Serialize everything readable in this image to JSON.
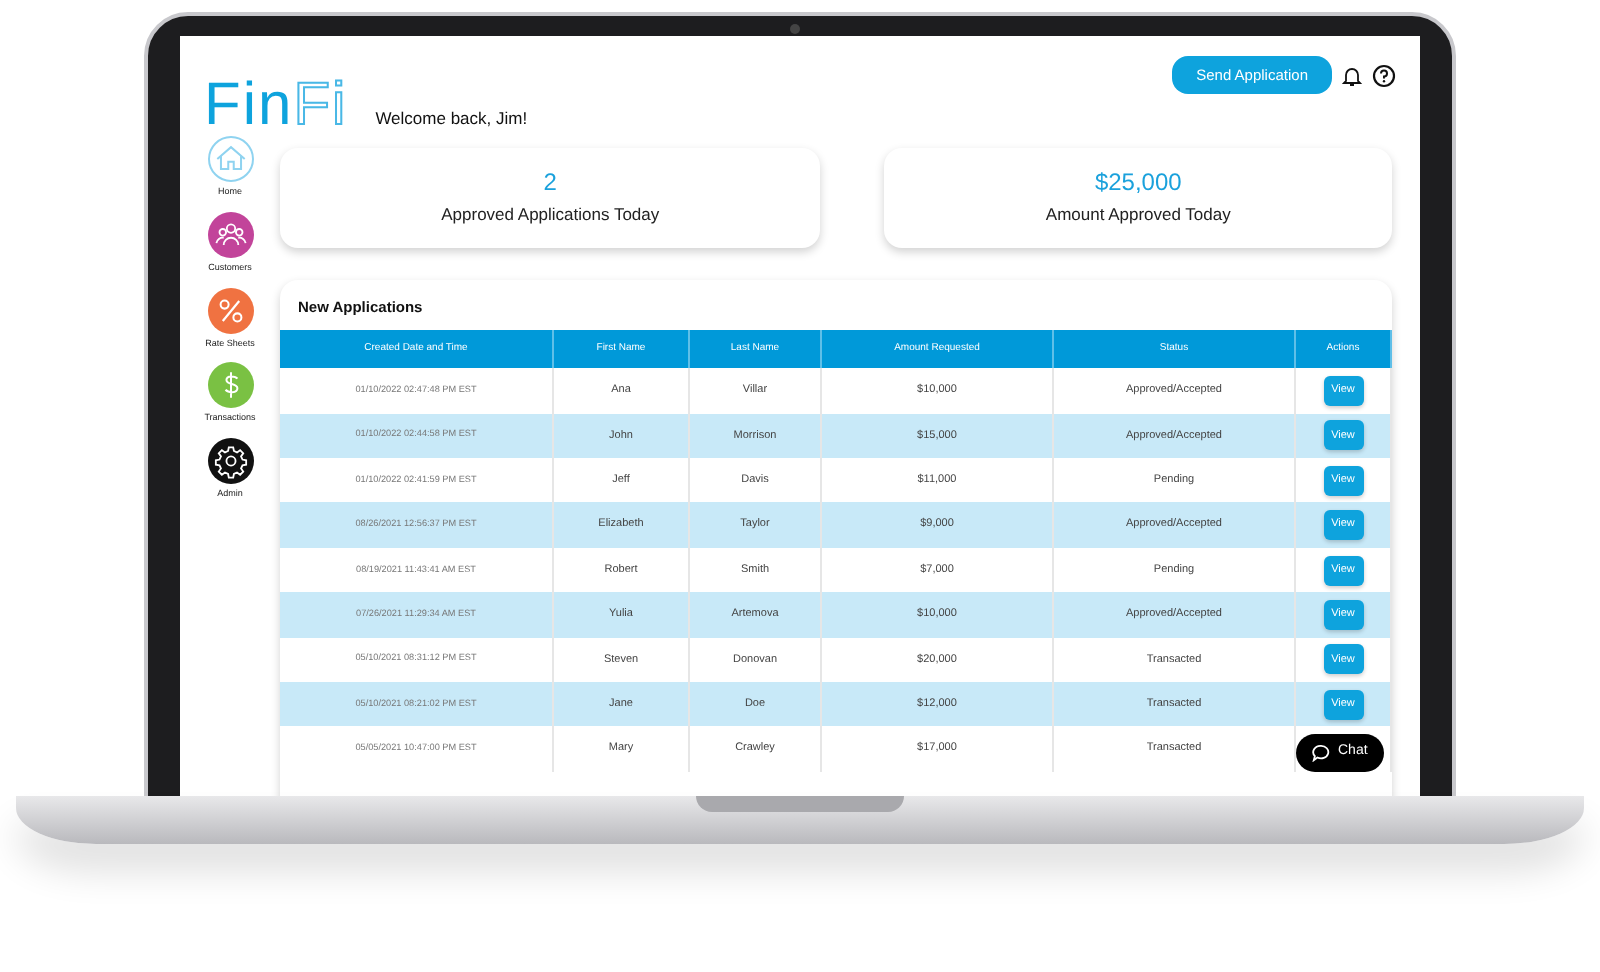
{
  "logo": {
    "solid": "Fin",
    "outline": "Fi"
  },
  "welcome": "Welcome back, Jim!",
  "header_button": "Send Application",
  "sidebar": {
    "items": [
      {
        "label": "Home",
        "kind": "home",
        "color": "#8fd3f0",
        "selected": true
      },
      {
        "label": "Customers",
        "kind": "people",
        "color": "#c2449a",
        "selected": false
      },
      {
        "label": "Rate Sheets",
        "kind": "percent",
        "color": "#f07241",
        "selected": false
      },
      {
        "label": "Transactions",
        "kind": "dollar",
        "color": "#7ac143",
        "selected": false
      },
      {
        "label": "Admin",
        "kind": "gear",
        "color": "#111111",
        "selected": false
      }
    ]
  },
  "stats": [
    {
      "value": "2",
      "label": "Approved Applications Today"
    },
    {
      "value": "$25,000",
      "label": "Amount Approved Today"
    }
  ],
  "table": {
    "title": "New Applications",
    "columns": [
      "Created Date and Time",
      "First Name",
      "Last Name",
      "Amount Requested",
      "Status",
      "Actions"
    ],
    "rows": [
      {
        "created": "01/10/2022 02:47:48 PM EST",
        "first": "Ana",
        "last": "Villar",
        "amount": "$10,000",
        "status": "Approved/Accepted",
        "action": "View"
      },
      {
        "created": "01/10/2022 02:44:58 PM EST",
        "first": "John",
        "last": "Morrison",
        "amount": "$15,000",
        "status": "Approved/Accepted",
        "action": "View"
      },
      {
        "created": "01/10/2022 02:41:59 PM EST",
        "first": "Jeff",
        "last": "Davis",
        "amount": "$11,000",
        "status": "Pending",
        "action": "View"
      },
      {
        "created": "08/26/2021 12:56:37 PM EST",
        "first": "Elizabeth",
        "last": "Taylor",
        "amount": "$9,000",
        "status": "Approved/Accepted",
        "action": "View"
      },
      {
        "created": "08/19/2021 11:43:41 AM EST",
        "first": "Robert",
        "last": "Smith",
        "amount": "$7,000",
        "status": "Pending",
        "action": "View"
      },
      {
        "created": "07/26/2021 11:29:34 AM EST",
        "first": "Yulia",
        "last": "Artemova",
        "amount": "$10,000",
        "status": "Approved/Accepted",
        "action": "View"
      },
      {
        "created": "05/10/2021 08:31:12 PM EST",
        "first": "Steven",
        "last": "Donovan",
        "amount": "$20,000",
        "status": "Transacted",
        "action": "View"
      },
      {
        "created": "05/10/2021 08:21:02 PM EST",
        "first": "Jane",
        "last": "Doe",
        "amount": "$12,000",
        "status": "Transacted",
        "action": "View"
      },
      {
        "created": "05/05/2021 10:47:00 PM EST",
        "first": "Mary",
        "last": "Crawley",
        "amount": "$17,000",
        "status": "Transacted"
      }
    ]
  },
  "chat_button": "Chat"
}
